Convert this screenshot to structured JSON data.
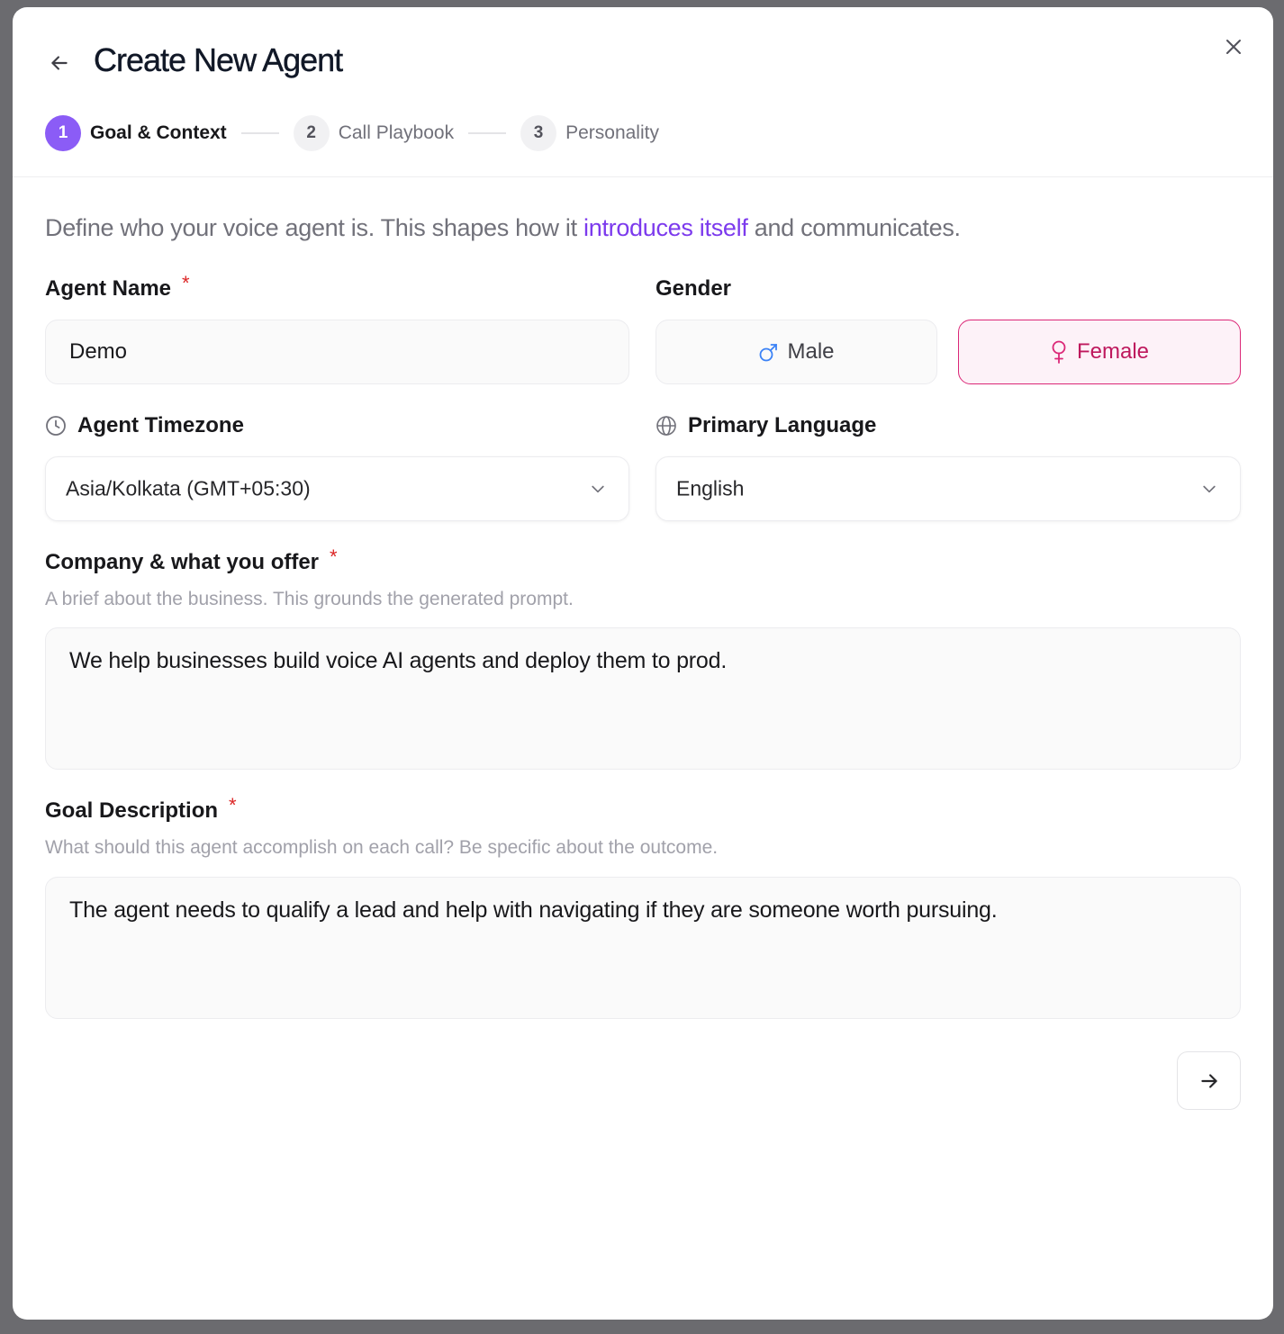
{
  "header": {
    "title": "Create New Agent",
    "back_icon": "arrow-left-icon",
    "close_icon": "close-icon"
  },
  "stepper": {
    "steps": [
      {
        "number": "1",
        "label": "Goal & Context",
        "active": true
      },
      {
        "number": "2",
        "label": "Call Playbook",
        "active": false
      },
      {
        "number": "3",
        "label": "Personality",
        "active": false
      }
    ]
  },
  "intro": {
    "before": "Define who your voice agent is. This shapes how it ",
    "highlight": "introduces itself",
    "after": " and communicates."
  },
  "agent_name": {
    "label": "Agent Name",
    "required": "*",
    "value": "Demo"
  },
  "gender": {
    "label": "Gender",
    "options": [
      {
        "label": "Male",
        "icon": "male-icon",
        "selected": false
      },
      {
        "label": "Female",
        "icon": "female-icon",
        "selected": true
      }
    ]
  },
  "timezone": {
    "label": "Agent Timezone",
    "icon": "clock-icon",
    "value": "Asia/Kolkata (GMT+05:30)"
  },
  "language": {
    "label": "Primary Language",
    "icon": "globe-icon",
    "value": "English"
  },
  "company": {
    "label": "Company & what you offer",
    "required": "*",
    "hint": "A brief about the business. This grounds the generated prompt.",
    "value": "We help businesses build voice AI agents and deploy them to prod."
  },
  "goal": {
    "label": "Goal Description",
    "required": "*",
    "hint": "What should this agent accomplish on each call? Be specific about the outcome.",
    "value": "The agent needs to qualify a lead and help with navigating if they are someone worth pursuing."
  },
  "colors": {
    "accent": "#8b5cf6",
    "link": "#7c3aed",
    "female": "#db2777",
    "male": "#3b82f6",
    "required": "#dc2626"
  },
  "footer": {
    "next_icon": "arrow-right-icon"
  }
}
